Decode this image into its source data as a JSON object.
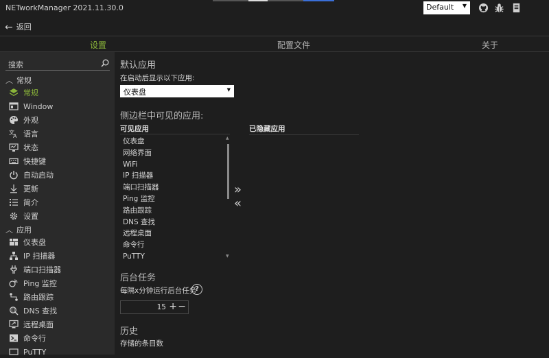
{
  "app": {
    "title": "NETworkManager 2021.11.30.0"
  },
  "profile": {
    "selected": "Default"
  },
  "titlebar": {
    "icons": [
      "github-icon",
      "bug-icon",
      "document-icon"
    ]
  },
  "nav": {
    "back_label": "返回"
  },
  "tabs": [
    {
      "label": "设置",
      "active": true
    },
    {
      "label": "配置文件",
      "active": false
    },
    {
      "label": "关于",
      "active": false
    }
  ],
  "sidebar": {
    "search_placeholder": "搜索",
    "groups": [
      {
        "label": "常规",
        "items": [
          {
            "label": "常规",
            "icon": "layers-icon",
            "active": true
          },
          {
            "label": "Window",
            "icon": "window-icon"
          },
          {
            "label": "外观",
            "icon": "palette-icon"
          },
          {
            "label": "语言",
            "icon": "translate-icon"
          },
          {
            "label": "状态",
            "icon": "monitor-status-icon"
          },
          {
            "label": "快捷键",
            "icon": "keyboard-icon"
          },
          {
            "label": "自动启动",
            "icon": "power-icon"
          },
          {
            "label": "更新",
            "icon": "download-icon"
          },
          {
            "label": "简介",
            "icon": "list-icon"
          },
          {
            "label": "设置",
            "icon": "gear-icon"
          }
        ]
      },
      {
        "label": "应用",
        "items": [
          {
            "label": "仪表盘",
            "icon": "dashboard-icon"
          },
          {
            "label": "IP 扫描器",
            "icon": "network-icon"
          },
          {
            "label": "端口扫描器",
            "icon": "port-icon"
          },
          {
            "label": "Ping 监控",
            "icon": "ping-icon"
          },
          {
            "label": "路由跟踪",
            "icon": "trace-icon"
          },
          {
            "label": "DNS 查找",
            "icon": "dns-icon"
          },
          {
            "label": "远程桌面",
            "icon": "remote-desktop-icon"
          },
          {
            "label": "命令行",
            "icon": "terminal-icon"
          },
          {
            "label": "PuTTY",
            "icon": "putty-icon"
          }
        ]
      }
    ]
  },
  "main": {
    "default_app": {
      "title": "默认应用",
      "label": "在启动后显示以下应用:",
      "selected": "仪表盘"
    },
    "sidebar_apps": {
      "title": "侧边栏中可见的应用:",
      "visible_header": "可见应用",
      "hidden_header": "已隐藏应用",
      "visible": [
        "仪表盘",
        "网络界面",
        "WiFi",
        "IP 扫描器",
        "端口扫描器",
        "Ping 监控",
        "路由跟踪",
        "DNS 查找",
        "远程桌面",
        "命令行",
        "PuTTY"
      ],
      "hidden": [],
      "move_right": "»",
      "move_left": "«"
    },
    "background": {
      "title": "后台任务",
      "label": "每隔x分钟运行后台任务",
      "value": "15"
    },
    "history": {
      "title": "历史",
      "label": "存储的条目数"
    }
  }
}
